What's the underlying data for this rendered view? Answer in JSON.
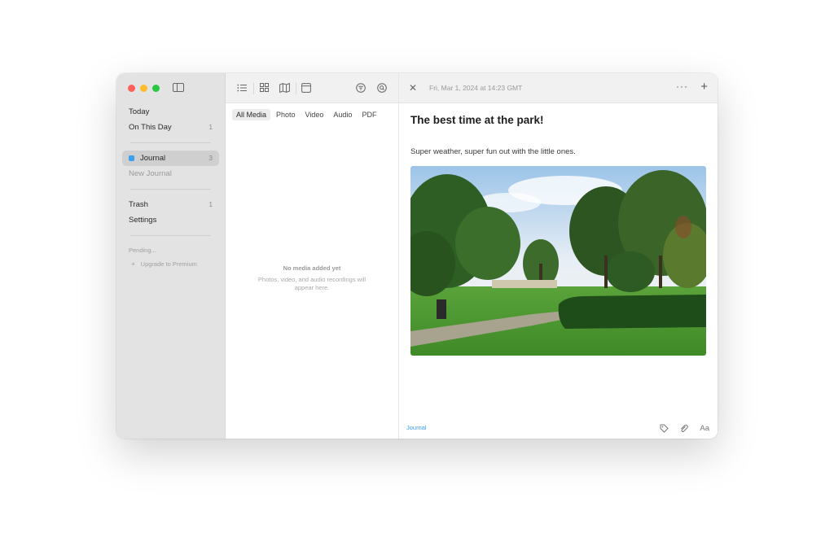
{
  "sidebar": {
    "items": [
      {
        "label": "Today",
        "count": ""
      },
      {
        "label": "On This Day",
        "count": "1"
      },
      {
        "label": "Journal",
        "count": "3"
      },
      {
        "label": "New Journal",
        "count": ""
      },
      {
        "label": "Trash",
        "count": "1"
      },
      {
        "label": "Settings",
        "count": ""
      }
    ],
    "pending": "Pending...",
    "upgrade": "Upgrade to Premium",
    "journal_color": "#3aa0ee"
  },
  "media": {
    "tabs": [
      "All Media",
      "Photo",
      "Video",
      "Audio",
      "PDF"
    ],
    "active_tab": "All Media",
    "empty_title": "No media added yet",
    "empty_subtitle": "Photos, video, and audio recordings will appear here."
  },
  "editor": {
    "date": "Fri, Mar 1, 2024 at 14:23 GMT",
    "title": "The best time at the park!",
    "body": "Super weather, super fun out with the little ones.",
    "journal_label": "Journal",
    "font_button": "Aa"
  },
  "icons": {
    "list": "list-icon",
    "grid": "grid-icon",
    "map": "map-icon",
    "calendar": "calendar-icon",
    "filter": "filter-icon",
    "search": "search-icon",
    "close": "close-icon",
    "more": "more-icon",
    "add": "plus-icon",
    "tag": "tag-icon",
    "attach": "paperclip-icon"
  }
}
